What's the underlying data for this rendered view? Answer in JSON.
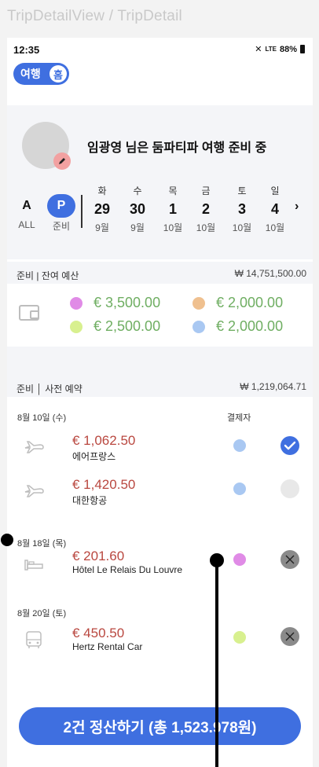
{
  "view_label": "TripDetailView / TripDetail",
  "status_bar": {
    "time": "12:35",
    "signal": "LTE",
    "battery": "88%"
  },
  "mode_toggle": {
    "label": "여행",
    "knob": "홈"
  },
  "hero": {
    "title": "임광영 님은  둠파티파 여행 준비 중"
  },
  "filters": [
    {
      "big": "A",
      "small": "ALL"
    },
    {
      "big": "P",
      "small": "준비"
    }
  ],
  "dates": [
    {
      "dow": "화",
      "day": "29",
      "mon": "9월"
    },
    {
      "dow": "수",
      "day": "30",
      "mon": "9월"
    },
    {
      "dow": "목",
      "day": "1",
      "mon": "10월"
    },
    {
      "dow": "금",
      "day": "2",
      "mon": "10월"
    },
    {
      "dow": "토",
      "day": "3",
      "mon": "10월"
    },
    {
      "dow": "일",
      "day": "4",
      "mon": "10월"
    }
  ],
  "budget_section": {
    "label": "준비 | 잔여 예산",
    "total": "₩ 14,751,500.00"
  },
  "budget_items": [
    {
      "color": "#e08be6",
      "amount": "€ 3,500.00"
    },
    {
      "color": "#efc08f",
      "amount": "€ 2,000.00"
    },
    {
      "color": "#d8f08f",
      "amount": "€ 2,500.00"
    },
    {
      "color": "#a9c8f2",
      "amount": "€ 2,000.00"
    }
  ],
  "reservation_section": {
    "label": "준비 │ 사전 예약",
    "total": "₩ 1,219,064.71"
  },
  "payer_label": "결제자",
  "date_headers": [
    "8월 10일 (수)",
    "8월 18일 (목)",
    "8월 20일 (토)"
  ],
  "reservations": [
    {
      "icon": "airplane-icon",
      "price": "€ 1,062.50",
      "vendor": "에어프랑스",
      "payer_color": "#a9c8f2",
      "status": "checked"
    },
    {
      "icon": "airplane-icon",
      "price": "€ 1,420.50",
      "vendor": "대한항공",
      "payer_color": "#a9c8f2",
      "status": "empty"
    },
    {
      "icon": "bed-icon",
      "price": "€ 201.60",
      "vendor": "Hôtel Le Relais Du Louvre",
      "payer_color": "#e08be6",
      "status": "cancel"
    },
    {
      "icon": "bus-icon",
      "price": "€ 450.50",
      "vendor": "Hertz Rental Car",
      "payer_color": "#d8f08f",
      "status": "cancel"
    }
  ],
  "settle_button": "2건 정산하기 (총 1,523.978원)",
  "colors": {
    "accent": "#3f6fe0",
    "price": "#b9473f",
    "budget": "#6fae62"
  }
}
